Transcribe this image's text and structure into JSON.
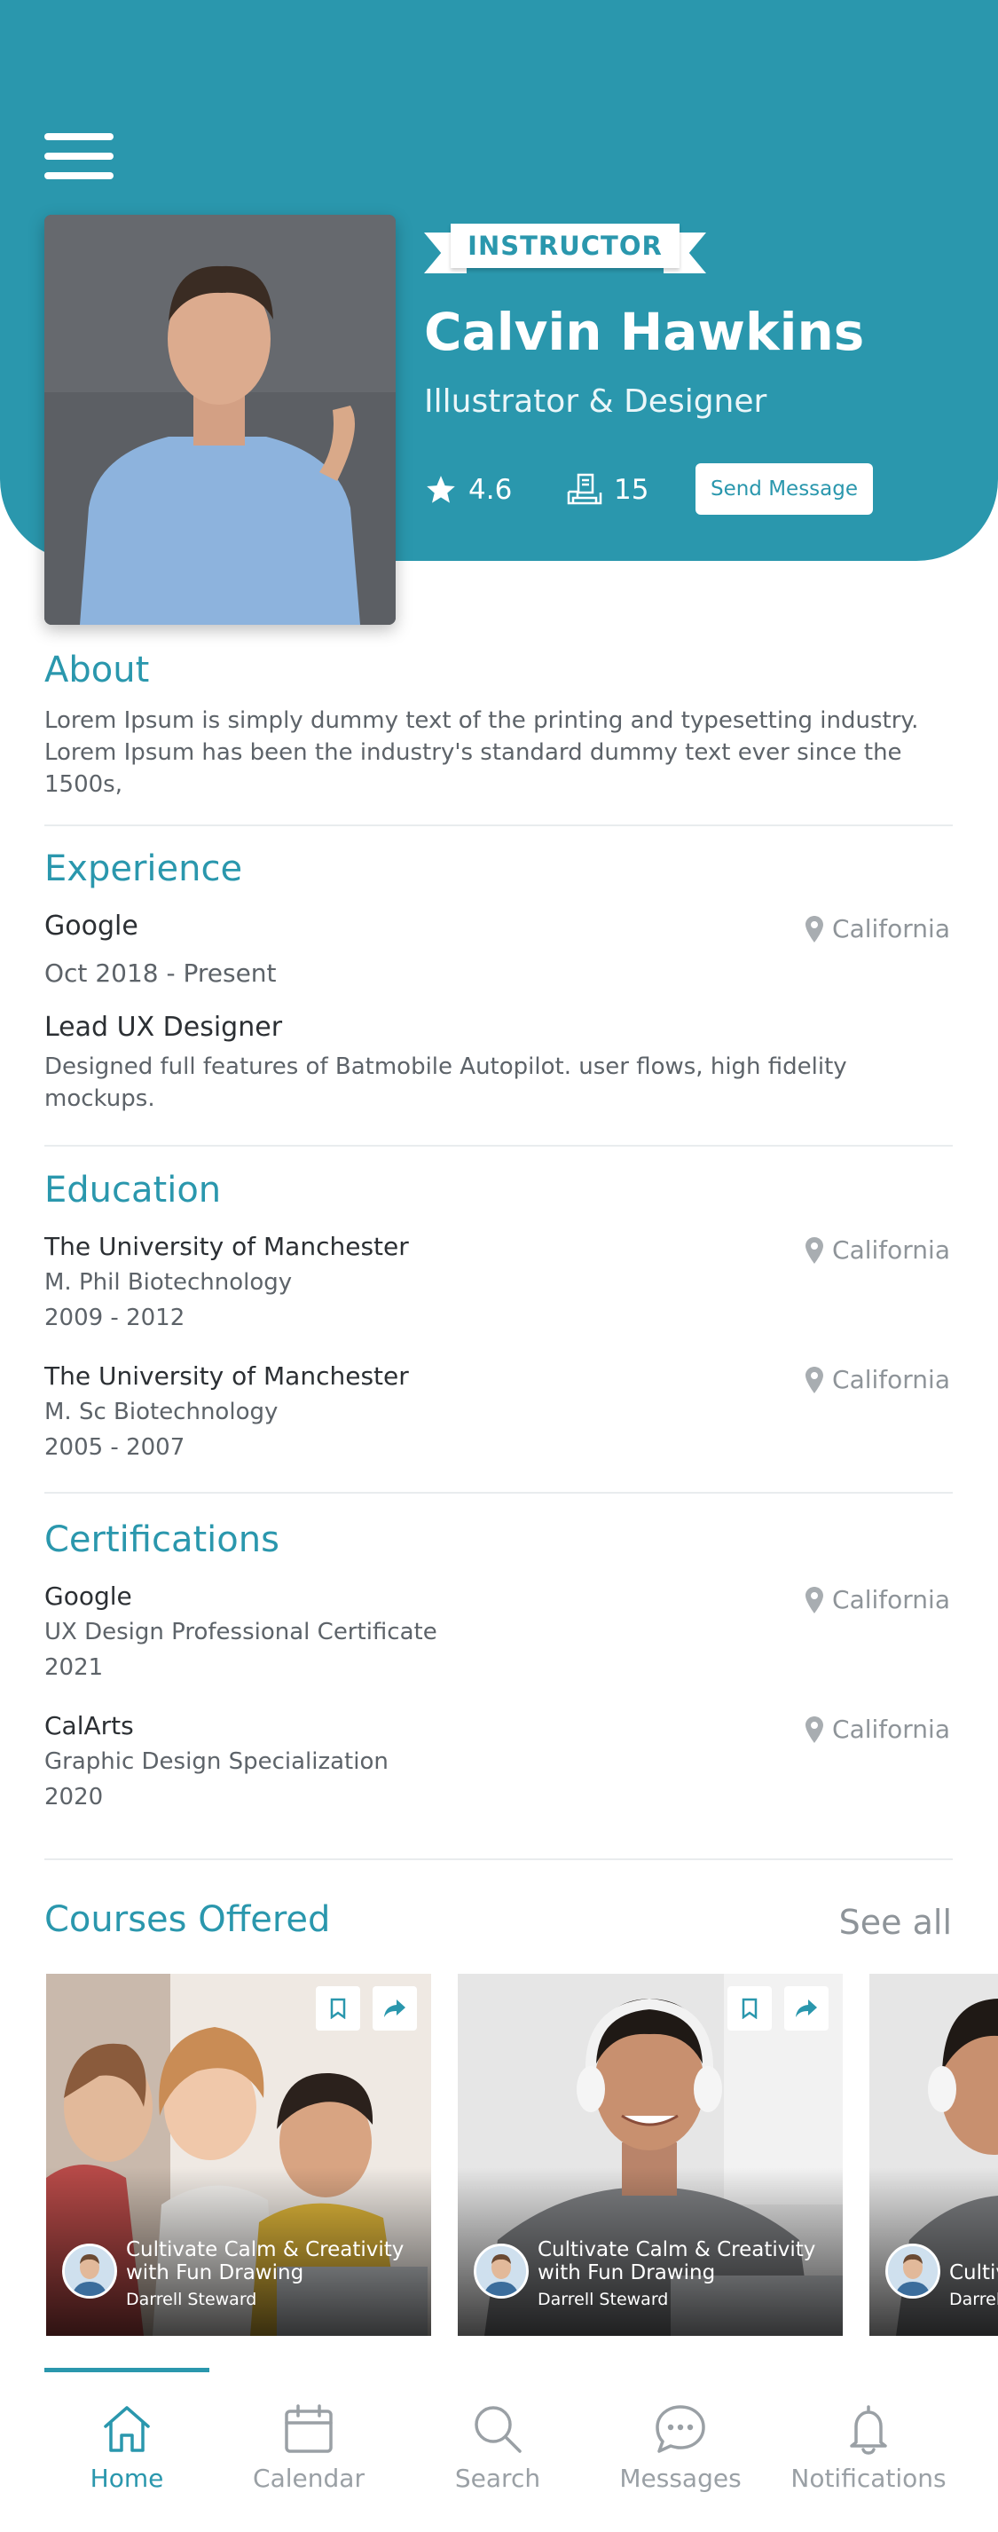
{
  "profile": {
    "badge": "INSTRUCTOR",
    "name": "Calvin Hawkins",
    "role": "Illustrator & Designer",
    "rating": "4.6",
    "courses_count": "15",
    "send_message_label": "Send Message"
  },
  "about": {
    "title": "About",
    "text": "Lorem Ipsum is simply dummy text of the printing and typesetting industry. Lorem Ipsum has been the industry's standard dummy text ever since the 1500s,"
  },
  "experience": {
    "title": "Experience",
    "company": "Google",
    "location": "California",
    "period": "Oct 2018 - Present",
    "position": "Lead UX Designer",
    "description": "Designed full features of Batmobile Autopilot. user flows, high fidelity mockups."
  },
  "education": {
    "title": "Education",
    "items": [
      {
        "school": "The University of Manchester",
        "degree": "M. Phil Biotechnology",
        "years": "2009 - 2012",
        "location": "California"
      },
      {
        "school": "The University of Manchester",
        "degree": "M. Sc Biotechnology",
        "years": "2005 - 2007",
        "location": "California"
      }
    ]
  },
  "certifications": {
    "title": "Certifications",
    "items": [
      {
        "issuer": "Google",
        "name": "UX Design Professional Certificate",
        "year": "2021",
        "location": "California"
      },
      {
        "issuer": "CalArts",
        "name": "Graphic Design Specialization",
        "year": "2020",
        "location": "California"
      }
    ]
  },
  "courses": {
    "title": "Courses Offered",
    "see_all": "See all",
    "items": [
      {
        "title": "Cultivate Calm & Creativity with Fun Drawing",
        "author": "Darrell Steward"
      },
      {
        "title": "Cultivate Calm & Creativity with Fun Drawing",
        "author": "Darrell Steward"
      },
      {
        "title": "Cultivate Calm & Creativity with Fun Drawing",
        "author": "Darrell Steward"
      }
    ]
  },
  "tabs": [
    {
      "label": "Home",
      "icon": "home-icon",
      "active": true
    },
    {
      "label": "Calendar",
      "icon": "calendar-icon",
      "active": false
    },
    {
      "label": "Search",
      "icon": "search-icon",
      "active": false
    },
    {
      "label": "Messages",
      "icon": "messages-icon",
      "active": false
    },
    {
      "label": "Notifications",
      "icon": "bell-icon",
      "active": false
    }
  ],
  "colors": {
    "accent": "#2a97ad",
    "muted": "#8e9499"
  }
}
